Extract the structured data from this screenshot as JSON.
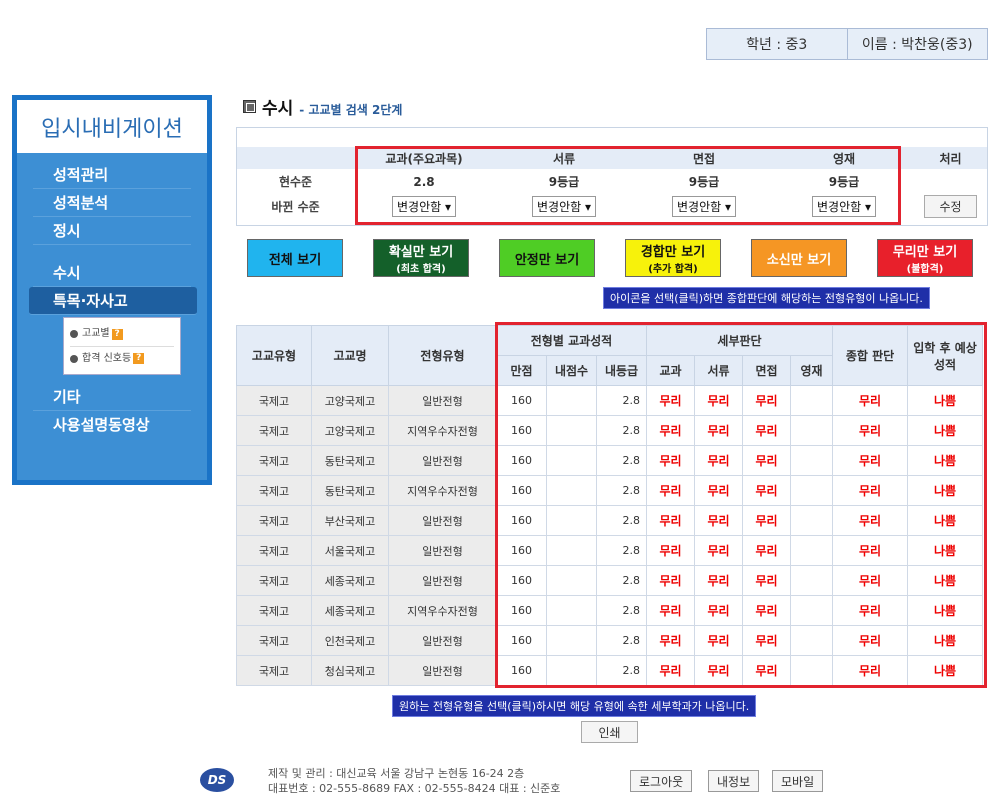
{
  "top": {
    "grade": "학년 : 중3",
    "name": "이름 : 박찬웅(중3)"
  },
  "sidebar": {
    "title": "입시내비게이션",
    "items": [
      "성적관리",
      "성적분석",
      "정시",
      "수시",
      "특목·자사고"
    ],
    "sub": [
      "고교별",
      "합격 신호등"
    ],
    "items2": [
      "기타",
      "사용설명동영상"
    ]
  },
  "heading": {
    "title": "수시",
    "sub": "- 고교별 검색 2단계"
  },
  "levels": {
    "headers": [
      "교과(주요과목)",
      "서류",
      "면접",
      "영재",
      "처리"
    ],
    "row1_label": "현수준",
    "row1": [
      "2.8",
      "9등급",
      "9등급",
      "9등급"
    ],
    "row2_label": "바뀐 수준",
    "select_label": "변경안함",
    "edit": "수정"
  },
  "filters": [
    {
      "label": "전체 보기",
      "sub": "",
      "color": "#20b4ee",
      "text": "#111"
    },
    {
      "label": "확실만 보기",
      "sub": "(최초 합격)",
      "color": "#14602a",
      "text": "#fff"
    },
    {
      "label": "안정만 보기",
      "sub": "",
      "color": "#4fcd25",
      "text": "#111"
    },
    {
      "label": "경합만 보기",
      "sub": "(추가 합격)",
      "color": "#f7f20b",
      "text": "#111"
    },
    {
      "label": "소신만 보기",
      "sub": "",
      "color": "#f59624",
      "text": "#fff"
    },
    {
      "label": "무리만 보기",
      "sub": "(불합격)",
      "color": "#e8202b",
      "text": "#fff"
    }
  ],
  "notice1": "아이콘을 선택(클릭)하면 종합판단에 해당하는 전형유형이 나옵니다.",
  "table": {
    "h_type": "고교유형",
    "h_school": "고교명",
    "h_admission": "전형유형",
    "h_group1": "전형별 교과성적",
    "h_group2": "세부판단",
    "h_total": "종합 판단",
    "h_expect": "입학 후 예상성적",
    "sub1": [
      "만점",
      "내점수",
      "내등급"
    ],
    "sub2": [
      "교과",
      "서류",
      "면접",
      "영재"
    ],
    "rows": [
      {
        "type": "국제고",
        "school": "고양국제고",
        "adm": "일반전형",
        "full": "160",
        "score": "",
        "grade": "2.8",
        "d1": "무리",
        "d2": "무리",
        "d3": "무리",
        "d4": "",
        "total": "무리",
        "expect": "나쁨"
      },
      {
        "type": "국제고",
        "school": "고양국제고",
        "adm": "지역우수자전형",
        "full": "160",
        "score": "",
        "grade": "2.8",
        "d1": "무리",
        "d2": "무리",
        "d3": "무리",
        "d4": "",
        "total": "무리",
        "expect": "나쁨"
      },
      {
        "type": "국제고",
        "school": "동탄국제고",
        "adm": "일반전형",
        "full": "160",
        "score": "",
        "grade": "2.8",
        "d1": "무리",
        "d2": "무리",
        "d3": "무리",
        "d4": "",
        "total": "무리",
        "expect": "나쁨"
      },
      {
        "type": "국제고",
        "school": "동탄국제고",
        "adm": "지역우수자전형",
        "full": "160",
        "score": "",
        "grade": "2.8",
        "d1": "무리",
        "d2": "무리",
        "d3": "무리",
        "d4": "",
        "total": "무리",
        "expect": "나쁨"
      },
      {
        "type": "국제고",
        "school": "부산국제고",
        "adm": "일반전형",
        "full": "160",
        "score": "",
        "grade": "2.8",
        "d1": "무리",
        "d2": "무리",
        "d3": "무리",
        "d4": "",
        "total": "무리",
        "expect": "나쁨"
      },
      {
        "type": "국제고",
        "school": "서울국제고",
        "adm": "일반전형",
        "full": "160",
        "score": "",
        "grade": "2.8",
        "d1": "무리",
        "d2": "무리",
        "d3": "무리",
        "d4": "",
        "total": "무리",
        "expect": "나쁨"
      },
      {
        "type": "국제고",
        "school": "세종국제고",
        "adm": "일반전형",
        "full": "160",
        "score": "",
        "grade": "2.8",
        "d1": "무리",
        "d2": "무리",
        "d3": "무리",
        "d4": "",
        "total": "무리",
        "expect": "나쁨"
      },
      {
        "type": "국제고",
        "school": "세종국제고",
        "adm": "지역우수자전형",
        "full": "160",
        "score": "",
        "grade": "2.8",
        "d1": "무리",
        "d2": "무리",
        "d3": "무리",
        "d4": "",
        "total": "무리",
        "expect": "나쁨"
      },
      {
        "type": "국제고",
        "school": "인천국제고",
        "adm": "일반전형",
        "full": "160",
        "score": "",
        "grade": "2.8",
        "d1": "무리",
        "d2": "무리",
        "d3": "무리",
        "d4": "",
        "total": "무리",
        "expect": "나쁨"
      },
      {
        "type": "국제고",
        "school": "청심국제고",
        "adm": "일반전형",
        "full": "160",
        "score": "",
        "grade": "2.8",
        "d1": "무리",
        "d2": "무리",
        "d3": "무리",
        "d4": "",
        "total": "무리",
        "expect": "나쁨"
      }
    ]
  },
  "notice2": "원하는 전형유형을 선택(클릭)하시면 해당 유형에 속한 세부학과가 나옵니다.",
  "print": "인쇄",
  "footer": {
    "logo": "DS",
    "line1": "제작 및 관리 : 대신교육 서울 강남구 논현동 16-24 2층",
    "line2": "대표번호 : 02-555-8689   FAX : 02-555-8424   대표 : 신준호",
    "logout": "로그아웃",
    "myinfo": "내정보",
    "mobile": "모바일"
  }
}
